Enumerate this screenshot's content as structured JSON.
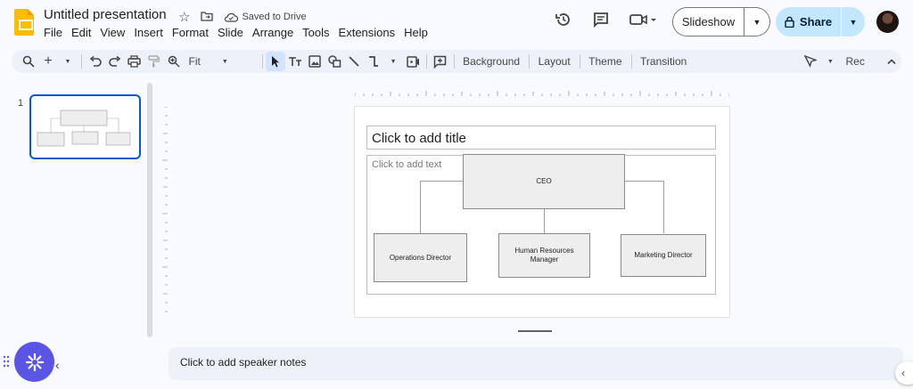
{
  "app": {
    "title": "Untitled presentation",
    "saved_status": "Saved to Drive"
  },
  "menu": [
    "File",
    "Edit",
    "View",
    "Insert",
    "Format",
    "Slide",
    "Arrange",
    "Tools",
    "Extensions",
    "Help"
  ],
  "header": {
    "slideshow_label": "Slideshow",
    "share_label": "Share"
  },
  "toolbar": {
    "zoom": "Fit",
    "background_label": "Background",
    "layout_label": "Layout",
    "theme_label": "Theme",
    "transition_label": "Transition",
    "rec_label": "Rec"
  },
  "filmstrip": {
    "slide_number": "1"
  },
  "slide": {
    "title_placeholder": "Click to add title",
    "body_placeholder": "Click to add text",
    "org_chart": {
      "root": "CEO",
      "children": [
        "Operations Director",
        "Human Resources Manager",
        "Marketing Director"
      ]
    }
  },
  "notes": {
    "placeholder": "Click to add speaker notes"
  },
  "colors": {
    "accent": "#0b57d0",
    "share_bg": "#c2e7ff",
    "toolbar_bg": "#edf2fa",
    "fab": "#5b55e6",
    "logo": "#fbbc04"
  }
}
